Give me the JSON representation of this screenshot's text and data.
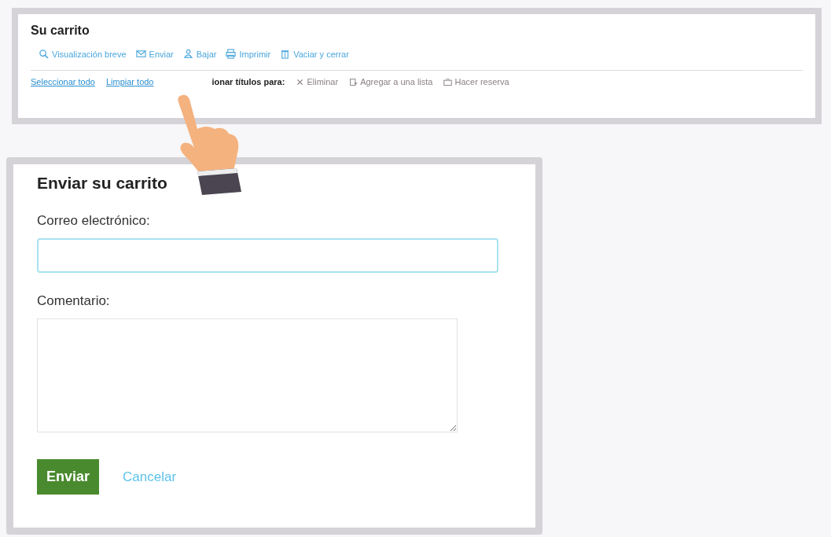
{
  "cart": {
    "title": "Su carrito",
    "toolbar": [
      {
        "kind": "search",
        "label": "Visualización breve"
      },
      {
        "kind": "envelope",
        "label": "Enviar"
      },
      {
        "kind": "person",
        "label": "Bajar"
      },
      {
        "kind": "printer",
        "label": "Imprimir"
      },
      {
        "kind": "trash",
        "label": "Vaciar y cerrar"
      }
    ],
    "links": [
      "Seleccionar todo",
      "Limpiar todo"
    ],
    "select_label": "ionar títulos para:",
    "actions": [
      {
        "kind": "close",
        "label": "Eliminar"
      },
      {
        "kind": "list",
        "label": "Agregar a una lista"
      },
      {
        "kind": "reserve",
        "label": "Hacer reserva"
      }
    ]
  },
  "dialog": {
    "title": "Enviar su carrito",
    "email_label": "Correo electrónico:",
    "comment_label": "Comentario:",
    "submit": "Enviar",
    "cancel": "Cancelar"
  }
}
